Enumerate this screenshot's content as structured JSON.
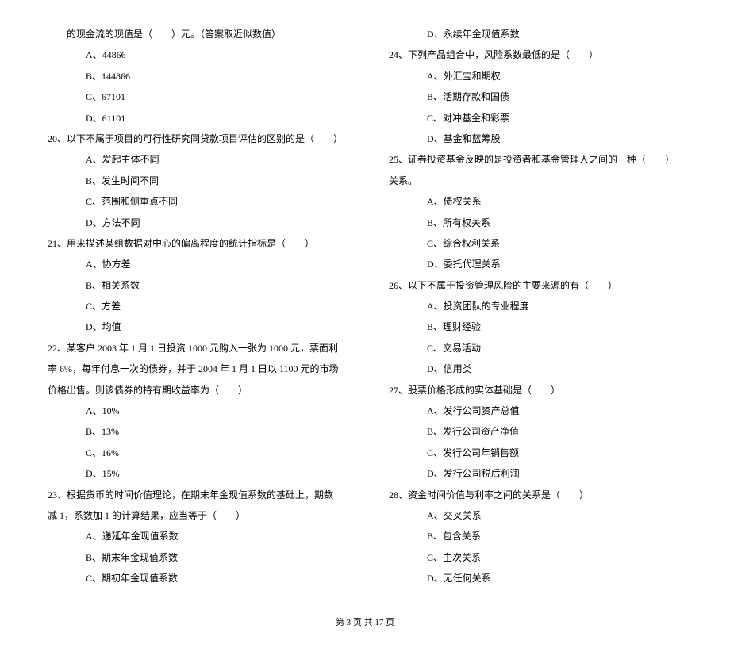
{
  "leftCol": {
    "intro": "的现金流的现值是（　　）元。（答案取近似数值）",
    "q19opts": [
      "A、44866",
      "B、144866",
      "C、67101",
      "D、61101"
    ],
    "q20": "20、以下不属于项目的可行性研究同贷款项目评估的区别的是（　　）",
    "q20opts": [
      "A、发起主体不同",
      "B、发生时间不同",
      "C、范围和侧重点不同",
      "D、方法不同"
    ],
    "q21": "21、用来描述某组数据对中心的偏离程度的统计指标是（　　）",
    "q21opts": [
      "A、协方差",
      "B、相关系数",
      "C、方差",
      "D、均值"
    ],
    "q22": "22、某客户 2003 年 1 月 1 日投资 1000 元购入一张为 1000 元，票面利率 6%，每年付息一次的债券，并于 2004 年 1 月 1 日以 1100 元的市场价格出售。则该债券的持有期收益率为（　　）",
    "q22opts": [
      "A、10%",
      "B、13%",
      "C、16%",
      "D、15%"
    ],
    "q23": "23、根据货币的时间价值理论，在期末年金现值系数的基础上，期数减 1，系数加 1 的计算结果，应当等于（　　）",
    "q23opts": [
      "A、递延年金现值系数",
      "B、期末年金现值系数",
      "C、期初年金现值系数"
    ]
  },
  "rightCol": {
    "q23opt4": "D、永续年金现值系数",
    "q24": "24、下列产品组合中，风险系数最低的是（　　）",
    "q24opts": [
      "A、外汇宝和期权",
      "B、活期存款和国债",
      "C、对冲基金和彩票",
      "D、基金和蓝筹股"
    ],
    "q25": "25、证券投资基金反映的是投资者和基金管理人之间的一种（　　）关系。",
    "q25opts": [
      "A、债权关系",
      "B、所有权关系",
      "C、综合权利关系",
      "D、委托代理关系"
    ],
    "q26": "26、以下不属于投资管理风险的主要来源的有（　　）",
    "q26opts": [
      "A、投资团队的专业程度",
      "B、理财经验",
      "C、交易活动",
      "D、信用类"
    ],
    "q27": "27、股票价格形成的实体基础是（　　）",
    "q27opts": [
      "A、发行公司资产总值",
      "B、发行公司资产净值",
      "C、发行公司年销售额",
      "D、发行公司税后利润"
    ],
    "q28": "28、资金时间价值与利率之间的关系是（　　）",
    "q28opts": [
      "A、交叉关系",
      "B、包含关系",
      "C、主次关系",
      "D、无任何关系"
    ]
  },
  "footer": "第 3 页 共 17 页"
}
